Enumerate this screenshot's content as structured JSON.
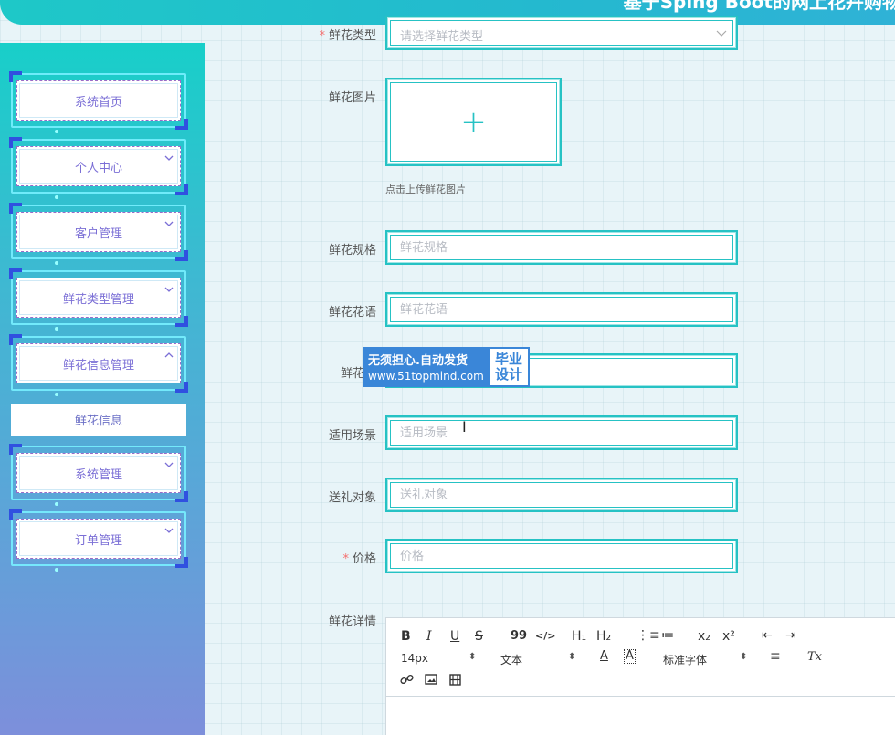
{
  "header": {
    "title": "基于Sping Boot的网上花卉购物"
  },
  "sidebar": {
    "items": [
      {
        "label": "系统首页",
        "has_arrow": false
      },
      {
        "label": "个人中心",
        "has_arrow": true
      },
      {
        "label": "客户管理",
        "has_arrow": true
      },
      {
        "label": "鲜花类型管理",
        "has_arrow": true
      },
      {
        "label": "鲜花信息管理",
        "has_arrow": true,
        "expanded": true
      },
      {
        "label": "系统管理",
        "has_arrow": true
      },
      {
        "label": "订单管理",
        "has_arrow": true
      }
    ],
    "submenu": {
      "label": "鲜花信息"
    }
  },
  "form": {
    "type": {
      "label": "鲜花类型",
      "placeholder": "请选择鲜花类型",
      "required": true
    },
    "image": {
      "label": "鲜花图片",
      "hint": "点击上传鲜花图片"
    },
    "spec": {
      "label": "鲜花规格",
      "placeholder": "鲜花规格"
    },
    "language": {
      "label": "鲜花花语",
      "placeholder": "鲜花花语"
    },
    "origin": {
      "label": "鲜花产",
      "placeholder": ""
    },
    "scene": {
      "label": "适用场景",
      "placeholder": "适用场景"
    },
    "target": {
      "label": "送礼对象",
      "placeholder": "送礼对象"
    },
    "price": {
      "label": "价格",
      "placeholder": "价格",
      "required": true
    },
    "detail": {
      "label": "鲜花详情"
    }
  },
  "watermark": {
    "line1": "无须担心.自动发货",
    "line2": "www.51topmind.com",
    "badge1": "毕业",
    "badge2": "设计"
  },
  "editor": {
    "font_size": "14px",
    "text_type": "文本",
    "font_family": "标准字体",
    "buttons": {
      "bold": "B",
      "italic": "I",
      "underline": "U",
      "strike": "S",
      "quote": "99",
      "code": "</>",
      "h1": "H₁",
      "h2": "H₂",
      "ol": "⋮≡",
      "ul": "≔",
      "sub": "x₂",
      "sup": "x²",
      "outdent": "⇤",
      "indent": "⇥",
      "color": "A",
      "bg": "A",
      "align": "≡",
      "clean": "Tx"
    }
  },
  "colors": {
    "accent": "#26c2c4",
    "menu_text": "#7b6fd6",
    "required": "#f56c6c"
  }
}
